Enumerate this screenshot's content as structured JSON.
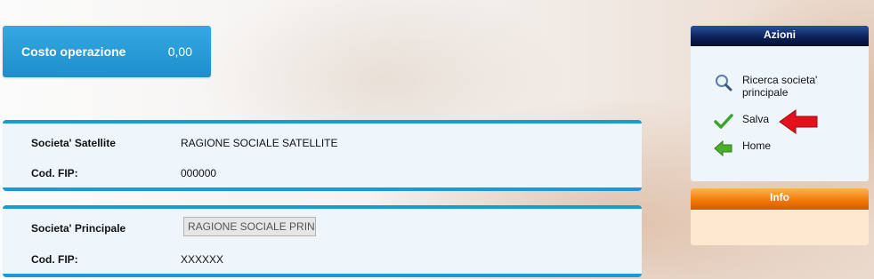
{
  "cost": {
    "label": "Costo operazione",
    "value": "0,00"
  },
  "satellite_panel": {
    "society_label": "Societa' Satellite",
    "society_value": "RAGIONE SOCIALE SATELLITE",
    "fip_label": "Cod. FIP:",
    "fip_value": "000000"
  },
  "principal_panel": {
    "society_label": "Societa' Principale",
    "society_value": "RAGIONE SOCIALE PRIN",
    "fip_label": "Cod. FIP:",
    "fip_value": "XXXXXX"
  },
  "actions": {
    "title": "Azioni",
    "items": [
      {
        "label": "Ricerca societa' principale",
        "icon": "magnifier-icon"
      },
      {
        "label": "Salva",
        "icon": "checkmark-icon"
      },
      {
        "label": "Home",
        "icon": "arrow-left-icon"
      }
    ]
  },
  "info": {
    "title": "Info"
  },
  "colors": {
    "accent_blue": "#1c9ad6",
    "header_dark": "#0a1f55",
    "info_orange": "#f27a0a",
    "arrow_red": "#e3101e"
  }
}
